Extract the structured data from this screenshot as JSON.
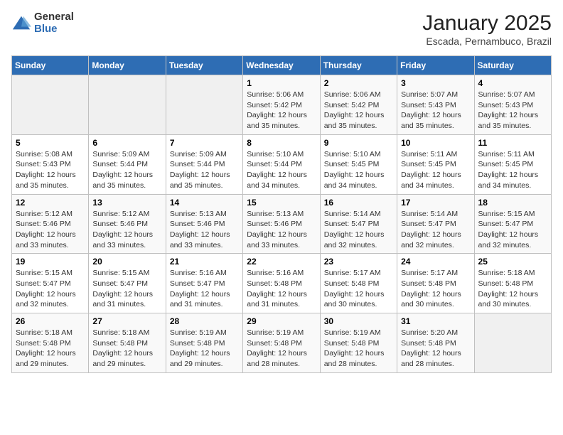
{
  "logo": {
    "general": "General",
    "blue": "Blue"
  },
  "header": {
    "title": "January 2025",
    "location": "Escada, Pernambuco, Brazil"
  },
  "days_of_week": [
    "Sunday",
    "Monday",
    "Tuesday",
    "Wednesday",
    "Thursday",
    "Friday",
    "Saturday"
  ],
  "weeks": [
    [
      {
        "day": "",
        "info": ""
      },
      {
        "day": "",
        "info": ""
      },
      {
        "day": "",
        "info": ""
      },
      {
        "day": "1",
        "info": "Sunrise: 5:06 AM\nSunset: 5:42 PM\nDaylight: 12 hours\nand 35 minutes."
      },
      {
        "day": "2",
        "info": "Sunrise: 5:06 AM\nSunset: 5:42 PM\nDaylight: 12 hours\nand 35 minutes."
      },
      {
        "day": "3",
        "info": "Sunrise: 5:07 AM\nSunset: 5:43 PM\nDaylight: 12 hours\nand 35 minutes."
      },
      {
        "day": "4",
        "info": "Sunrise: 5:07 AM\nSunset: 5:43 PM\nDaylight: 12 hours\nand 35 minutes."
      }
    ],
    [
      {
        "day": "5",
        "info": "Sunrise: 5:08 AM\nSunset: 5:43 PM\nDaylight: 12 hours\nand 35 minutes."
      },
      {
        "day": "6",
        "info": "Sunrise: 5:09 AM\nSunset: 5:44 PM\nDaylight: 12 hours\nand 35 minutes."
      },
      {
        "day": "7",
        "info": "Sunrise: 5:09 AM\nSunset: 5:44 PM\nDaylight: 12 hours\nand 35 minutes."
      },
      {
        "day": "8",
        "info": "Sunrise: 5:10 AM\nSunset: 5:44 PM\nDaylight: 12 hours\nand 34 minutes."
      },
      {
        "day": "9",
        "info": "Sunrise: 5:10 AM\nSunset: 5:45 PM\nDaylight: 12 hours\nand 34 minutes."
      },
      {
        "day": "10",
        "info": "Sunrise: 5:11 AM\nSunset: 5:45 PM\nDaylight: 12 hours\nand 34 minutes."
      },
      {
        "day": "11",
        "info": "Sunrise: 5:11 AM\nSunset: 5:45 PM\nDaylight: 12 hours\nand 34 minutes."
      }
    ],
    [
      {
        "day": "12",
        "info": "Sunrise: 5:12 AM\nSunset: 5:46 PM\nDaylight: 12 hours\nand 33 minutes."
      },
      {
        "day": "13",
        "info": "Sunrise: 5:12 AM\nSunset: 5:46 PM\nDaylight: 12 hours\nand 33 minutes."
      },
      {
        "day": "14",
        "info": "Sunrise: 5:13 AM\nSunset: 5:46 PM\nDaylight: 12 hours\nand 33 minutes."
      },
      {
        "day": "15",
        "info": "Sunrise: 5:13 AM\nSunset: 5:46 PM\nDaylight: 12 hours\nand 33 minutes."
      },
      {
        "day": "16",
        "info": "Sunrise: 5:14 AM\nSunset: 5:47 PM\nDaylight: 12 hours\nand 32 minutes."
      },
      {
        "day": "17",
        "info": "Sunrise: 5:14 AM\nSunset: 5:47 PM\nDaylight: 12 hours\nand 32 minutes."
      },
      {
        "day": "18",
        "info": "Sunrise: 5:15 AM\nSunset: 5:47 PM\nDaylight: 12 hours\nand 32 minutes."
      }
    ],
    [
      {
        "day": "19",
        "info": "Sunrise: 5:15 AM\nSunset: 5:47 PM\nDaylight: 12 hours\nand 32 minutes."
      },
      {
        "day": "20",
        "info": "Sunrise: 5:15 AM\nSunset: 5:47 PM\nDaylight: 12 hours\nand 31 minutes."
      },
      {
        "day": "21",
        "info": "Sunrise: 5:16 AM\nSunset: 5:47 PM\nDaylight: 12 hours\nand 31 minutes."
      },
      {
        "day": "22",
        "info": "Sunrise: 5:16 AM\nSunset: 5:48 PM\nDaylight: 12 hours\nand 31 minutes."
      },
      {
        "day": "23",
        "info": "Sunrise: 5:17 AM\nSunset: 5:48 PM\nDaylight: 12 hours\nand 30 minutes."
      },
      {
        "day": "24",
        "info": "Sunrise: 5:17 AM\nSunset: 5:48 PM\nDaylight: 12 hours\nand 30 minutes."
      },
      {
        "day": "25",
        "info": "Sunrise: 5:18 AM\nSunset: 5:48 PM\nDaylight: 12 hours\nand 30 minutes."
      }
    ],
    [
      {
        "day": "26",
        "info": "Sunrise: 5:18 AM\nSunset: 5:48 PM\nDaylight: 12 hours\nand 29 minutes."
      },
      {
        "day": "27",
        "info": "Sunrise: 5:18 AM\nSunset: 5:48 PM\nDaylight: 12 hours\nand 29 minutes."
      },
      {
        "day": "28",
        "info": "Sunrise: 5:19 AM\nSunset: 5:48 PM\nDaylight: 12 hours\nand 29 minutes."
      },
      {
        "day": "29",
        "info": "Sunrise: 5:19 AM\nSunset: 5:48 PM\nDaylight: 12 hours\nand 28 minutes."
      },
      {
        "day": "30",
        "info": "Sunrise: 5:19 AM\nSunset: 5:48 PM\nDaylight: 12 hours\nand 28 minutes."
      },
      {
        "day": "31",
        "info": "Sunrise: 5:20 AM\nSunset: 5:48 PM\nDaylight: 12 hours\nand 28 minutes."
      },
      {
        "day": "",
        "info": ""
      }
    ]
  ]
}
